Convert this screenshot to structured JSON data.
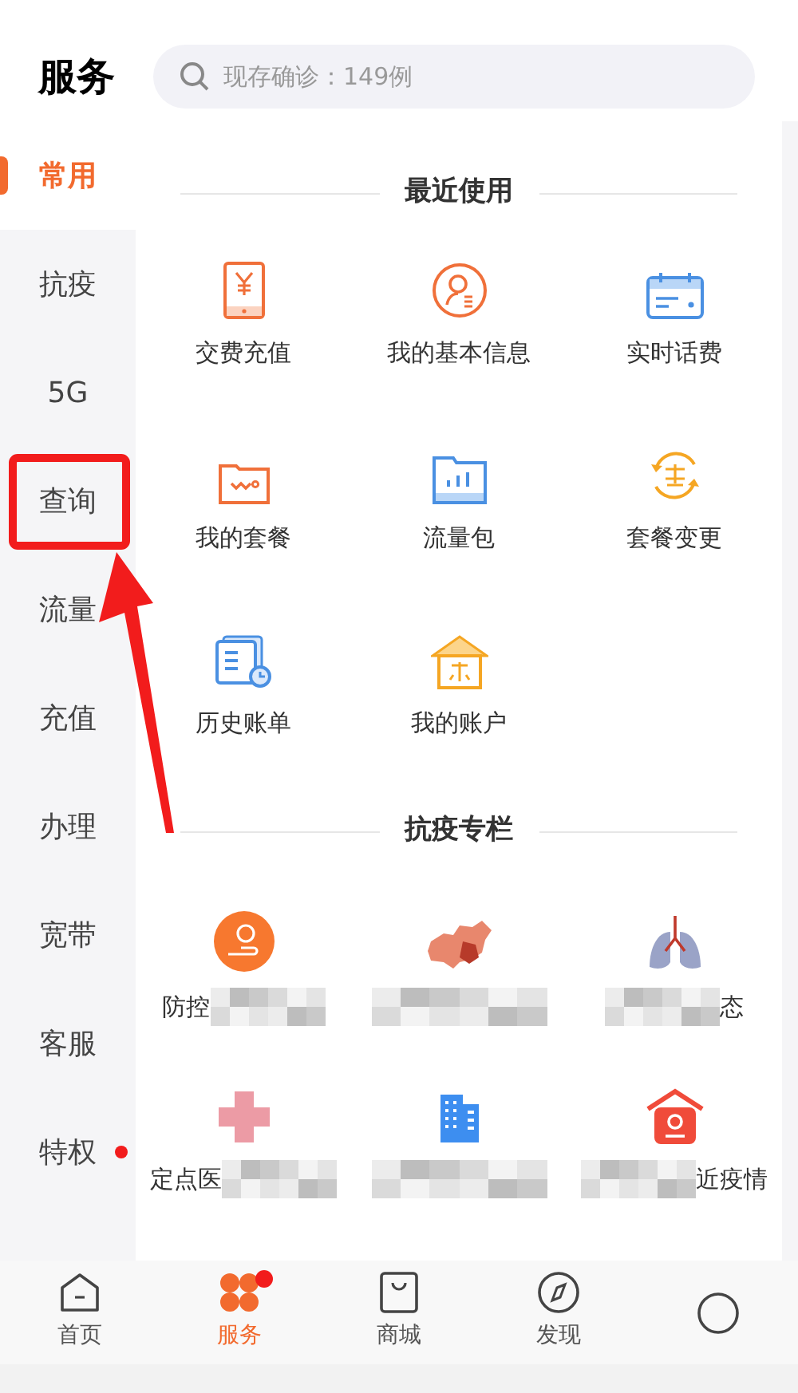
{
  "header": {
    "title": "服务",
    "search": {
      "placeholder": "现存确诊：149例"
    }
  },
  "sidebar": {
    "items": [
      {
        "label": "常用",
        "selected": true,
        "badge": false
      },
      {
        "label": "抗疫",
        "selected": false,
        "badge": false
      },
      {
        "label": "5G",
        "selected": false,
        "badge": false
      },
      {
        "label": "查询",
        "selected": false,
        "badge": false
      },
      {
        "label": "流量",
        "selected": false,
        "badge": false
      },
      {
        "label": "充值",
        "selected": false,
        "badge": false
      },
      {
        "label": "办理",
        "selected": false,
        "badge": false
      },
      {
        "label": "宽带",
        "selected": false,
        "badge": false
      },
      {
        "label": "客服",
        "selected": false,
        "badge": false
      },
      {
        "label": "特权",
        "selected": false,
        "badge": true
      }
    ]
  },
  "sections": [
    {
      "title": "最近使用",
      "items": [
        {
          "label": "交费充值"
        },
        {
          "label": "我的基本信息"
        },
        {
          "label": "实时话费"
        },
        {
          "label": "我的套餐"
        },
        {
          "label": "流量包"
        },
        {
          "label": "套餐变更"
        },
        {
          "label": "历史账单"
        },
        {
          "label": "我的账户"
        }
      ]
    },
    {
      "title": "抗疫专栏",
      "items": [
        {
          "label": "防控",
          "blur_before": false,
          "blur_after": true
        },
        {
          "blur_after": true
        },
        {
          "label": "态",
          "blur_before": true,
          "blur_after": false
        },
        {
          "label": "定点医",
          "blur_before": false,
          "blur_after": true
        },
        {
          "blur_after": true
        },
        {
          "label": "近疫情",
          "blur_before": true,
          "blur_after": false
        }
      ]
    }
  ],
  "tab_bar": [
    {
      "label": "首页",
      "selected": false,
      "badge": false
    },
    {
      "label": "服务",
      "selected": true,
      "badge": true
    },
    {
      "label": "商城",
      "selected": false,
      "badge": false
    },
    {
      "label": "发现",
      "selected": false,
      "badge": false
    },
    {
      "selected": false,
      "badge": false
    }
  ]
}
